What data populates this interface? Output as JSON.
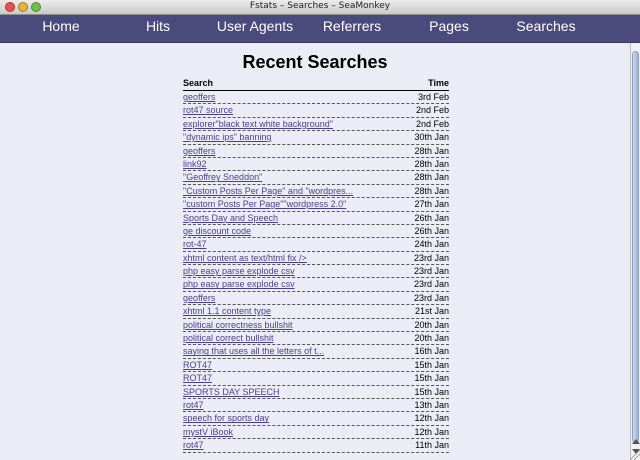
{
  "window": {
    "title": "Fstats – Searches – SeaMonkey"
  },
  "nav": {
    "home": "Home",
    "hits": "Hits",
    "user_agents": "User Agents",
    "referrers": "Referrers",
    "pages": "Pages",
    "searches": "Searches"
  },
  "page": {
    "title": "Recent Searches",
    "headers": {
      "search": "Search",
      "time": "Time"
    }
  },
  "rows": [
    {
      "q": "geoffers",
      "d": "3rd Feb"
    },
    {
      "q": "rot47 source",
      "d": "2nd Feb"
    },
    {
      "q": "explorer\"black text white background\"",
      "d": "2nd Feb"
    },
    {
      "q": "\"dynamic ips\" banning",
      "d": "30th Jan"
    },
    {
      "q": "geoffers",
      "d": "28th Jan"
    },
    {
      "q": "link92",
      "d": "28th Jan"
    },
    {
      "q": "\"Geoffrey Sneddon\"",
      "d": "28th Jan"
    },
    {
      "q": "\"Custom Posts Per Page\" and \"wordpres...",
      "d": "28th Jan"
    },
    {
      "q": "\"custom Posts Per Page\"\"wordpress 2.0\"",
      "d": "27th Jan"
    },
    {
      "q": "Sports Day and Speech",
      "d": "26th Jan"
    },
    {
      "q": "ge discount code",
      "d": "26th Jan"
    },
    {
      "q": "rot-47",
      "d": "24th Jan"
    },
    {
      "q": "xhtml content as text/html fix />",
      "d": "23rd Jan"
    },
    {
      "q": "php easy parse explode csv",
      "d": "23rd Jan"
    },
    {
      "q": "php easy parse explode csv",
      "d": "23rd Jan"
    },
    {
      "q": "geoffers",
      "d": "23rd Jan"
    },
    {
      "q": "xhtml 1.1 content type",
      "d": "21st Jan"
    },
    {
      "q": "political correctness bullshit",
      "d": "20th Jan"
    },
    {
      "q": "political correct bullshit",
      "d": "20th Jan"
    },
    {
      "q": "saying that uses all the letters of t...",
      "d": "16th Jan"
    },
    {
      "q": "ROT47",
      "d": "15th Jan"
    },
    {
      "q": "ROT47",
      "d": "15th Jan"
    },
    {
      "q": "SPORTS DAY SPEECH",
      "d": "15th Jan"
    },
    {
      "q": "rot47",
      "d": "13th Jan"
    },
    {
      "q": "speech for sports day",
      "d": "12th Jan"
    },
    {
      "q": "mystV iBook",
      "d": "12th Jan"
    },
    {
      "q": "rot47",
      "d": "11th Jan"
    }
  ]
}
